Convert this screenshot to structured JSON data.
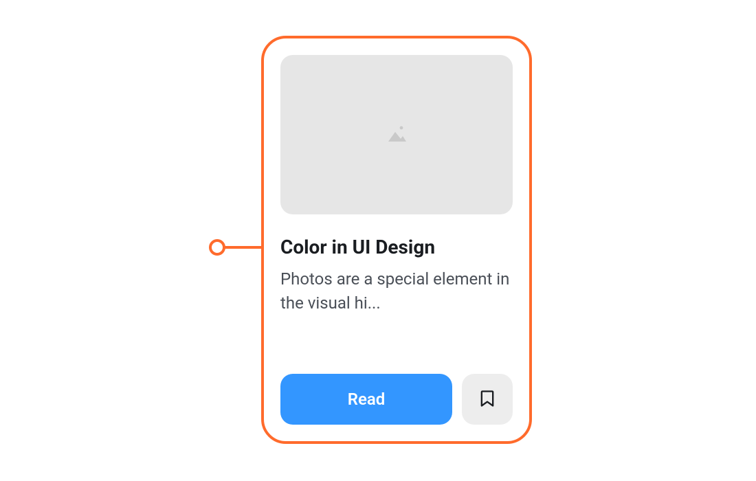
{
  "card": {
    "title": "Color in UI Design",
    "description": "Photos are a special element in the visual hi...",
    "actions": {
      "read_label": "Read"
    }
  },
  "colors": {
    "accent_orange": "#ff6b2c",
    "primary_blue": "#3396ff",
    "surface_grey": "#e6e6e6",
    "button_grey": "#ededed",
    "text_primary": "#1a1d21",
    "text_secondary": "#4a4f57"
  },
  "icons": {
    "image_placeholder": "image-icon",
    "bookmark": "bookmark-icon"
  }
}
